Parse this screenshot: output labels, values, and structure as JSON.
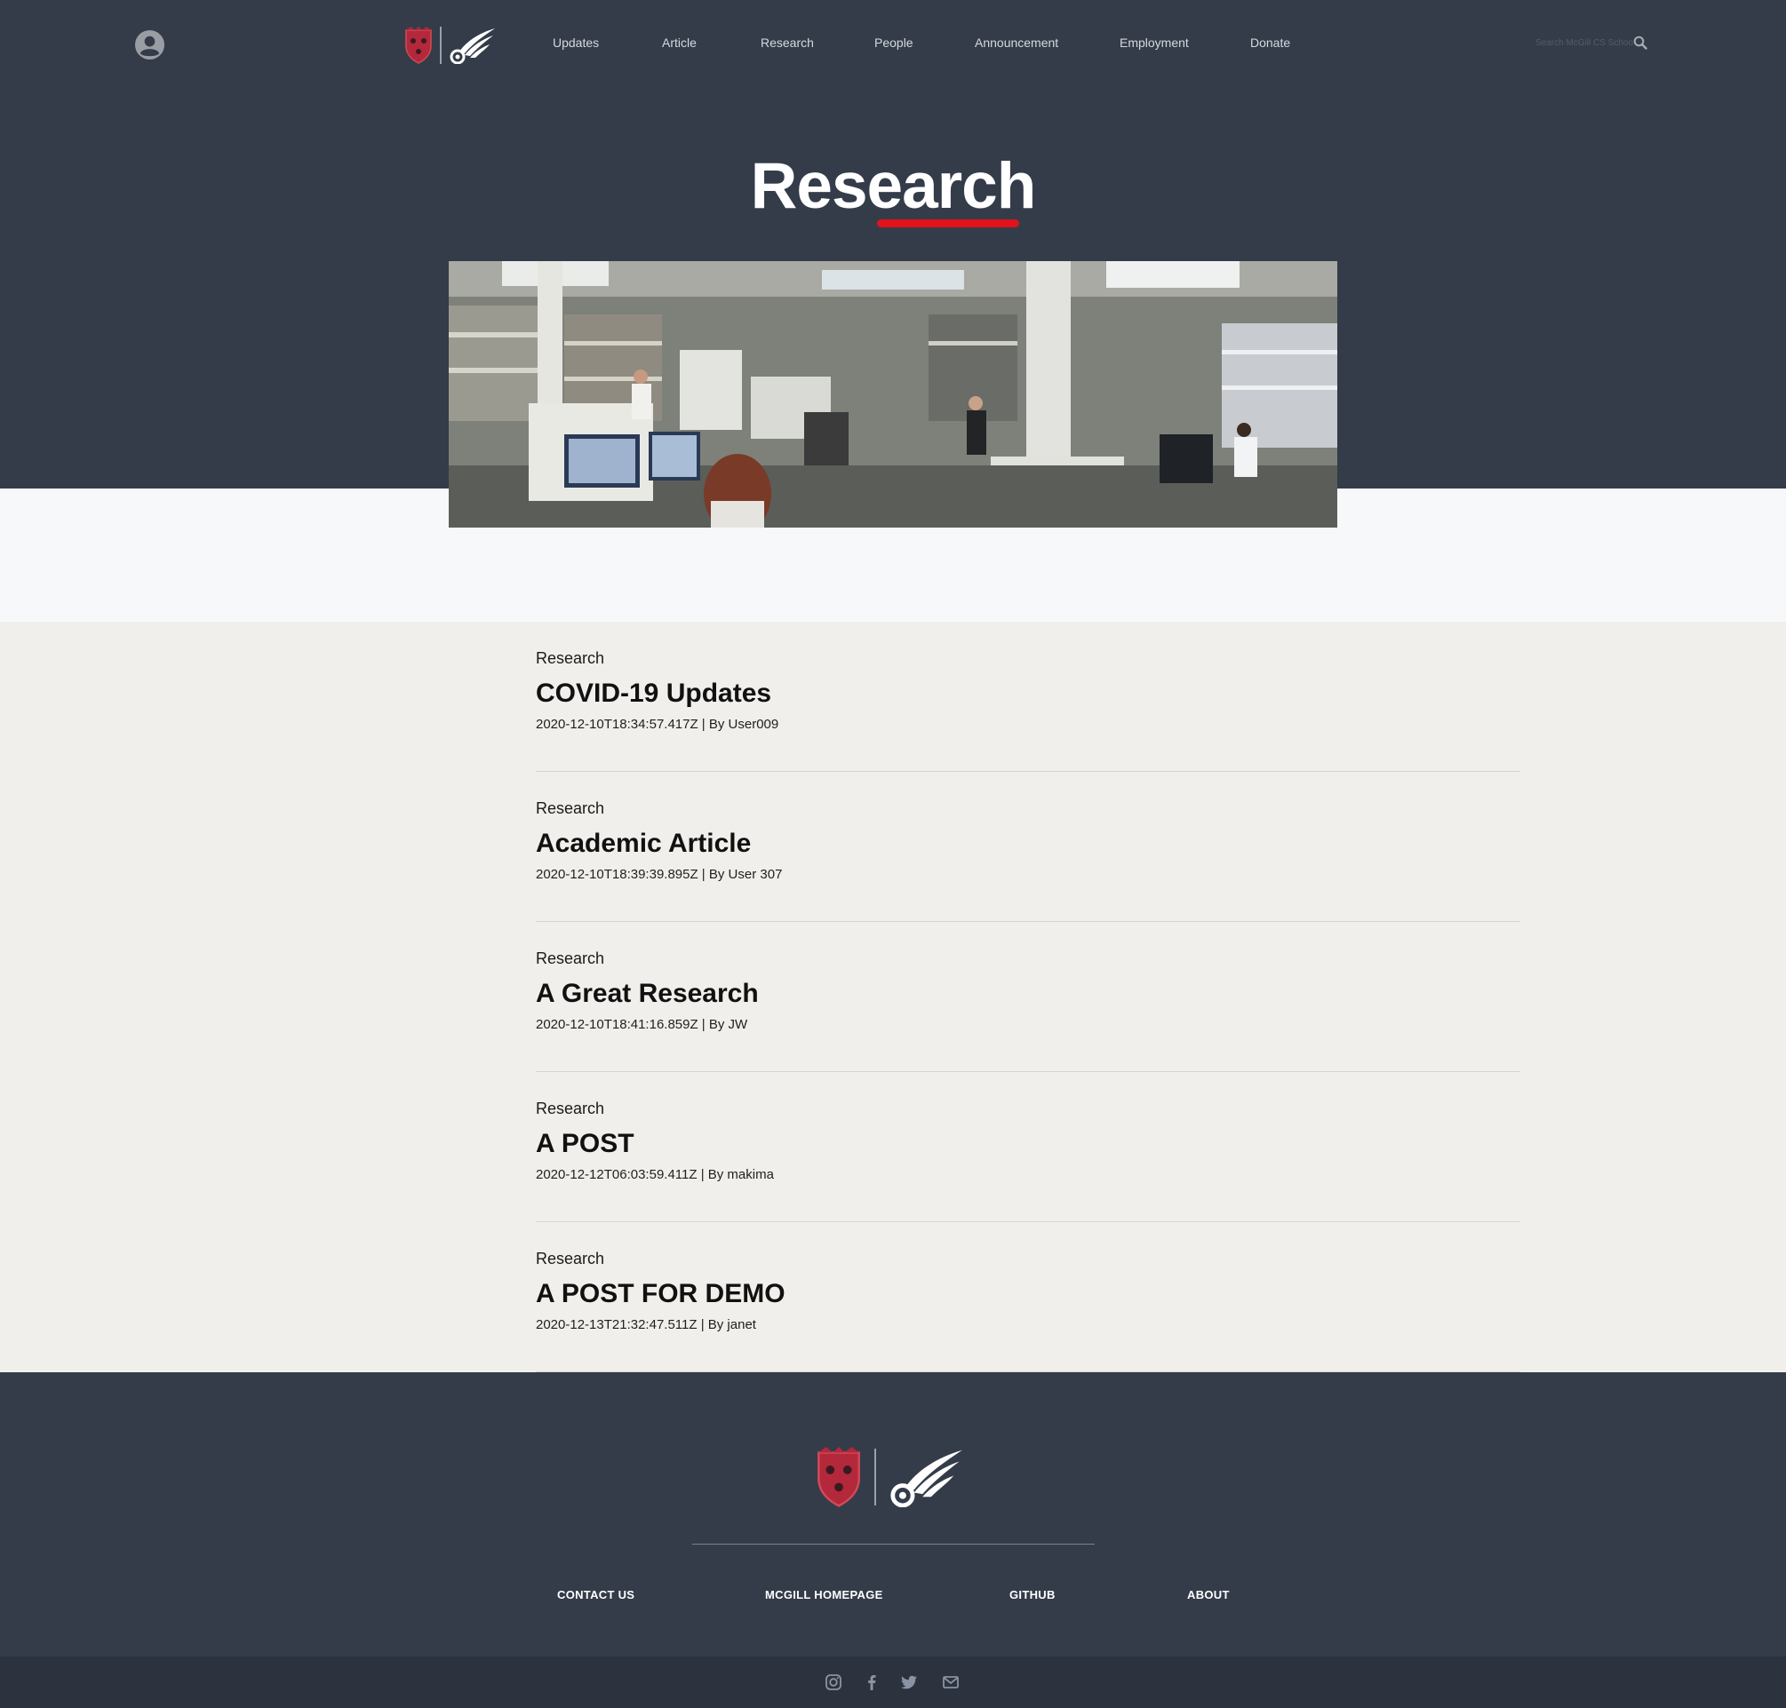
{
  "header": {
    "nav": [
      "Updates",
      "Article",
      "Research",
      "People",
      "Announcement",
      "Employment",
      "Donate"
    ],
    "search_placeholder": "Search McGill CS School"
  },
  "page": {
    "title": "Research"
  },
  "posts": [
    {
      "category": "Research",
      "title": "COVID-19 Updates",
      "meta": "2020-12-10T18:34:57.417Z | By User009"
    },
    {
      "category": "Research",
      "title": "Academic Article",
      "meta": "2020-12-10T18:39:39.895Z | By User 307"
    },
    {
      "category": "Research",
      "title": "A Great Research",
      "meta": "2020-12-10T18:41:16.859Z | By JW"
    },
    {
      "category": "Research",
      "title": "A POST",
      "meta": "2020-12-12T06:03:59.411Z | By makima"
    },
    {
      "category": "Research",
      "title": "A POST FOR DEMO",
      "meta": "2020-12-13T21:32:47.511Z | By janet"
    }
  ],
  "footer": {
    "links": [
      "CONTACT US",
      "MCGILL HOMEPAGE",
      "GITHUB",
      "ABOUT"
    ],
    "social_icons": [
      "instagram-icon",
      "facebook-icon",
      "twitter-icon",
      "email-icon"
    ]
  },
  "colors": {
    "header_bg": "#343c4a",
    "accent_red": "#e1131b",
    "content_bg": "#f0efeb",
    "bottom_bar": "#2c333f"
  }
}
